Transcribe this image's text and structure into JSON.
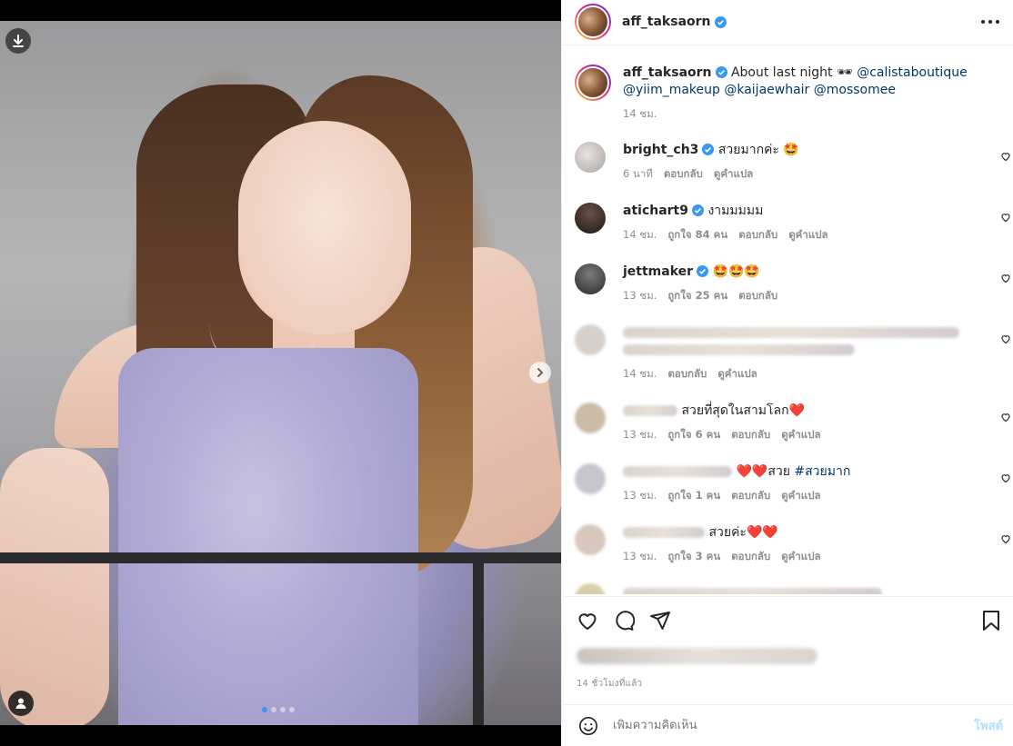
{
  "post": {
    "username": "aff_taksaorn",
    "caption_text": "About last night 🕶",
    "caption_mention_1": "@calistaboutique",
    "caption_mentions_2": "@yiim_makeup @kaijaewhair @mossomee",
    "caption_time": "14 ชม.",
    "timestamp": "14 ชั่วโมงที่แล้ว"
  },
  "comments": [
    {
      "username": "bright_ch3",
      "verified": true,
      "text": "สวยมากค่ะ 🤩",
      "time": "6 นาที",
      "likes": "",
      "reply": "ตอบกลับ",
      "translate": "ดูคำแปล"
    },
    {
      "username": "atichart9",
      "verified": true,
      "text": "งามมมมม",
      "time": "14 ชม.",
      "likes": "ถูกใจ 84 คน",
      "reply": "ตอบกลับ",
      "translate": "ดูคำแปล"
    },
    {
      "username": "jettmaker",
      "verified": true,
      "text": "🤩🤩🤩",
      "time": "13 ชม.",
      "likes": "ถูกใจ 25 คน",
      "reply": "ตอบกลับ",
      "translate": ""
    },
    {
      "username": "",
      "verified": false,
      "text": "",
      "time": "14 ชม.",
      "likes": "",
      "reply": "ตอบกลับ",
      "translate": "ดูคำแปล"
    },
    {
      "username": "",
      "verified": false,
      "text": "สวยที่สุดในสามโลก❤️",
      "time": "13 ชม.",
      "likes": "ถูกใจ 6 คน",
      "reply": "ตอบกลับ",
      "translate": "ดูคำแปล"
    },
    {
      "username": "",
      "verified": false,
      "text": "❤️❤️สวย",
      "hashtag": "#สวยมาก",
      "time": "13 ชม.",
      "likes": "ถูกใจ 1 คน",
      "reply": "ตอบกลับ",
      "translate": "ดูคำแปล"
    },
    {
      "username": "",
      "verified": false,
      "text": "สวยค่ะ❤️❤️",
      "time": "13 ชม.",
      "likes": "ถูกใจ 3 คน",
      "reply": "ตอบกลับ",
      "translate": "ดูคำแปล"
    }
  ],
  "composer": {
    "placeholder": "เพิ่มความคิดเห็น",
    "post_label": "โพสต์"
  },
  "carousel": {
    "slide_count": 4,
    "active_slide": 1
  },
  "icons": {
    "download": "download-icon",
    "next": "chevron-right-icon",
    "tag": "user-tag-icon",
    "more": "more-horizontal-icon",
    "like": "heart-icon",
    "comment": "comment-icon",
    "share": "send-icon",
    "save": "bookmark-icon",
    "emoji": "emoji-icon"
  },
  "colors": {
    "verified": "#3897f0",
    "link": "#00376b",
    "post_disabled": "#b2dffc"
  }
}
